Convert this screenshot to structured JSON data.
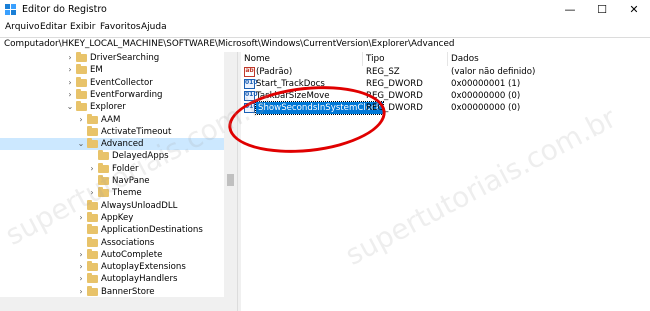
{
  "window": {
    "title": "Editor do Registro",
    "minimize_glyph": "—",
    "maximize_glyph": "☐",
    "close_glyph": "✕"
  },
  "menu": [
    "Arquivo",
    "Editar",
    "Exibir",
    "Favoritos",
    "Ajuda"
  ],
  "address": "Computador\\HKEY_LOCAL_MACHINE\\SOFTWARE\\Microsoft\\Windows\\CurrentVersion\\Explorer\\Advanced",
  "tree": [
    {
      "label": "DriverSearching",
      "depth": 0,
      "chevron": "›",
      "selected": false
    },
    {
      "label": "EM",
      "depth": 0,
      "chevron": "›",
      "selected": false
    },
    {
      "label": "EventCollector",
      "depth": 0,
      "chevron": "›",
      "selected": false
    },
    {
      "label": "EventForwarding",
      "depth": 0,
      "chevron": "›",
      "selected": false
    },
    {
      "label": "Explorer",
      "depth": 0,
      "chevron": "⌄",
      "selected": false
    },
    {
      "label": "AAM",
      "depth": 1,
      "chevron": "›",
      "selected": false
    },
    {
      "label": "ActivateTimeout",
      "depth": 1,
      "chevron": "",
      "selected": false
    },
    {
      "label": "Advanced",
      "depth": 1,
      "chevron": "⌄",
      "selected": true
    },
    {
      "label": "DelayedApps",
      "depth": 2,
      "chevron": "",
      "selected": false
    },
    {
      "label": "Folder",
      "depth": 2,
      "chevron": "›",
      "selected": false
    },
    {
      "label": "NavPane",
      "depth": 2,
      "chevron": "",
      "selected": false
    },
    {
      "label": "Theme",
      "depth": 2,
      "chevron": "›",
      "selected": false
    },
    {
      "label": "AlwaysUnloadDLL",
      "depth": 1,
      "chevron": "",
      "selected": false
    },
    {
      "label": "AppKey",
      "depth": 1,
      "chevron": "›",
      "selected": false
    },
    {
      "label": "ApplicationDestinations",
      "depth": 1,
      "chevron": "",
      "selected": false
    },
    {
      "label": "Associations",
      "depth": 1,
      "chevron": "",
      "selected": false
    },
    {
      "label": "AutoComplete",
      "depth": 1,
      "chevron": "›",
      "selected": false
    },
    {
      "label": "AutoplayExtensions",
      "depth": 1,
      "chevron": "›",
      "selected": false
    },
    {
      "label": "AutoplayHandlers",
      "depth": 1,
      "chevron": "›",
      "selected": false
    },
    {
      "label": "BannerStore",
      "depth": 1,
      "chevron": "›",
      "selected": false
    }
  ],
  "columns": {
    "name": "Nome",
    "type": "Tipo",
    "data": "Dados"
  },
  "values": [
    {
      "name": "(Padrão)",
      "type": "REG_SZ",
      "data": "(valor não definido)",
      "icon": "string-value-icon",
      "icon_text": "ab",
      "selected": false
    },
    {
      "name": "Start_TrackDocs",
      "type": "REG_DWORD",
      "data": "0x00000001 (1)",
      "icon": "binary-value-icon",
      "icon_text": "010",
      "selected": false
    },
    {
      "name": "TaskbarSizeMove",
      "type": "REG_DWORD",
      "data": "0x00000000 (0)",
      "icon": "binary-value-icon",
      "icon_text": "010",
      "selected": false
    },
    {
      "name": "ShowSecondsInSystemClock",
      "type": "REG_DWORD",
      "data": "0x00000000 (0)",
      "icon": "binary-value-icon",
      "icon_text": "010",
      "selected": true
    }
  ],
  "watermark": "supertutoriais.com.br",
  "colors": {
    "selection": "#0078d7",
    "tree_selection": "#cce8ff",
    "annotation": "#e00000",
    "folder": "#e8c36a"
  }
}
